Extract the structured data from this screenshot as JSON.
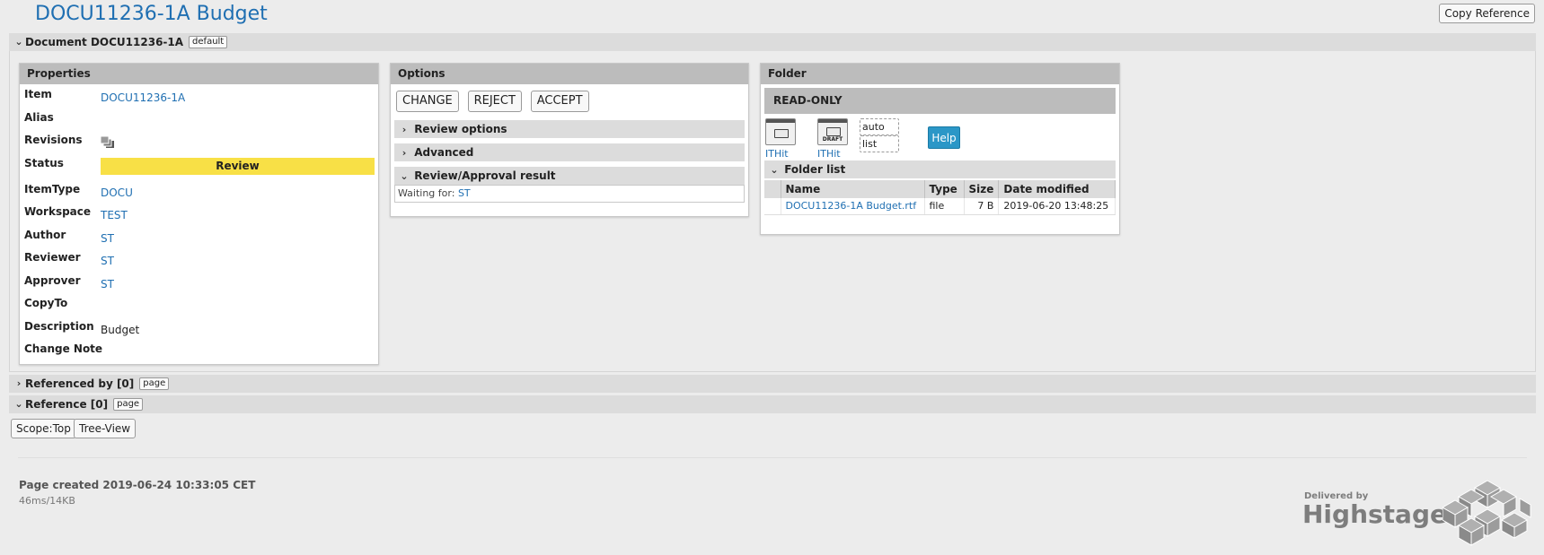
{
  "header": {
    "title": "DOCU11236-1A Budget",
    "copy_reference_label": "Copy Reference"
  },
  "document_section": {
    "title": "Document DOCU11236-1A",
    "tag": "default"
  },
  "properties": {
    "header": "Properties",
    "item_label": "Item",
    "item_value": "DOCU11236-1A",
    "alias_label": "Alias",
    "revisions_label": "Revisions",
    "status_label": "Status",
    "status_value": "Review",
    "itemtype_label": "ItemType",
    "itemtype_value": "DOCU",
    "workspace_label": "Workspace",
    "workspace_value": "TEST",
    "author_label": "Author",
    "author_value": "ST",
    "reviewer_label": "Reviewer",
    "reviewer_value": "ST",
    "approver_label": "Approver",
    "approver_value": "ST",
    "copyto_label": "CopyTo",
    "description_label": "Description",
    "description_value": "Budget",
    "change_note_label": "Change Note"
  },
  "options": {
    "header": "Options",
    "change_label": "CHANGE",
    "reject_label": "REJECT",
    "accept_label": "ACCEPT",
    "review_options_label": "Review options",
    "advanced_label": "Advanced",
    "result_label": "Review/Approval result",
    "waiting_prefix": "Waiting for:",
    "waiting_user": "ST"
  },
  "folder": {
    "header": "Folder",
    "readonly_label": "READ-ONLY",
    "icon1_label": "ITHit",
    "icon2_label": "ITHit",
    "icon2_badge": "DRAFT",
    "view_auto": "auto",
    "view_list": "list",
    "help_label": "Help",
    "folder_list_label": "Folder list",
    "columns": {
      "name": "Name",
      "type": "Type",
      "size": "Size",
      "date": "Date modified"
    },
    "files": [
      {
        "name": "DOCU11236-1A Budget.rtf",
        "type": "file",
        "size": "7 B",
        "date": "2019-06-20 13:48:25"
      }
    ]
  },
  "referenced_by": {
    "title": "Referenced by [0]",
    "tag": "page"
  },
  "reference": {
    "title": "Reference [0]",
    "tag": "page",
    "scope_label": "Scope:Top",
    "tree_view_label": "Tree-View"
  },
  "footer": {
    "created": "Page created 2019-06-24 10:33:05 CET",
    "stats": "46ms/14KB",
    "brand_sub": "Delivered by",
    "brand_name": "Highstage"
  },
  "colors": {
    "link": "#1f6fb2",
    "status_review": "#f8e046",
    "help": "#2b97c7"
  }
}
